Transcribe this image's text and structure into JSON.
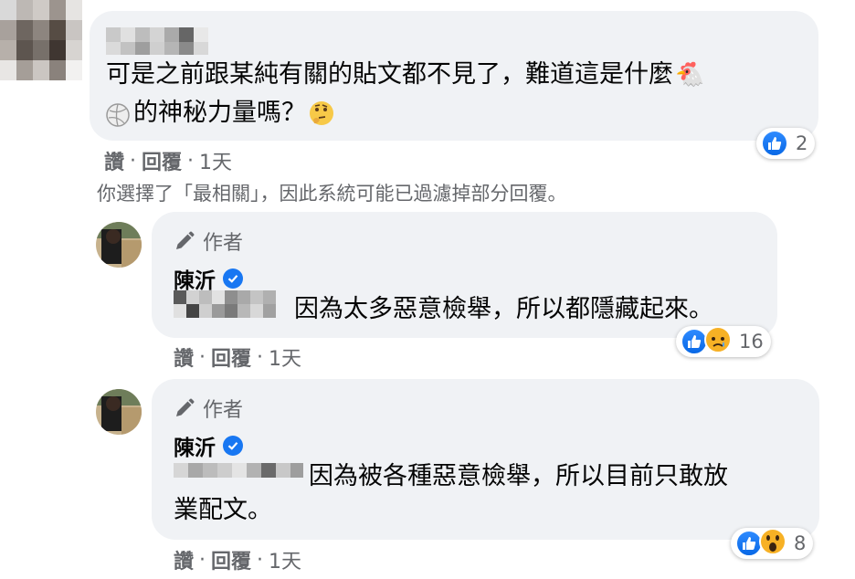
{
  "comments": [
    {
      "text_line1": "可是之前跟某純有關的貼文都不見了，難道這是什麼",
      "text_line2": "的神秘力量嗎？",
      "emoji_chicken": "🐔",
      "emoji_volleyball": "🏐",
      "emoji_thinking": "🤔",
      "like_label": "讚",
      "reply_label": "回覆",
      "separator": "·",
      "time": "1天",
      "reaction_count": "2",
      "reaction_icons": [
        "like-icon"
      ]
    }
  ],
  "filter_notice": "你選擇了「最相關」，因此系統可能已過濾掉部分回覆。",
  "replies": [
    {
      "author_tag": "作者",
      "name": "陳沂",
      "verified": true,
      "text": "因為太多惡意檢舉，所以都隱藏起來。",
      "like_label": "讚",
      "reply_label": "回覆",
      "separator": "·",
      "time": "1天",
      "reaction_count": "16",
      "reaction_icons": [
        "like-icon",
        "sad-icon"
      ]
    },
    {
      "author_tag": "作者",
      "name": "陳沂",
      "verified": true,
      "text_line1": "因為被各種惡意檢舉，所以目前只敢放",
      "text_line2": "業配文。",
      "like_label": "讚",
      "reply_label": "回覆",
      "separator": "·",
      "time": "1天",
      "reaction_count": "8",
      "reaction_icons": [
        "like-icon",
        "wow-icon"
      ]
    }
  ],
  "colors": {
    "bubble": "#f0f2f5",
    "like_blue": "#1877f2",
    "secondary_text": "#65676b"
  }
}
